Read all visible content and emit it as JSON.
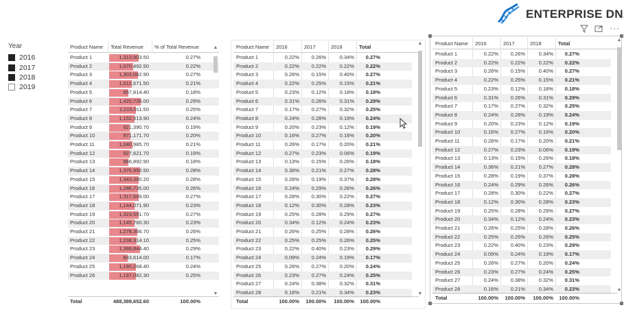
{
  "logo": {
    "text_main": "ENTERPRISE",
    "text_accent": "DNA"
  },
  "visual_header": {
    "filter_icon": "filter-icon",
    "focus_icon": "focus-mode-icon",
    "more_icon": "more-options-icon"
  },
  "slicer": {
    "title": "Year",
    "items": [
      {
        "label": "2016",
        "checked": true
      },
      {
        "label": "2017",
        "checked": true
      },
      {
        "label": "2018",
        "checked": true
      },
      {
        "label": "2019",
        "checked": false
      }
    ]
  },
  "table1": {
    "headers": [
      "Product Name",
      "Total Revenue",
      "% of Total Revenue"
    ],
    "rows": [
      [
        "Product 1",
        "1,313,903.50",
        "0.27%"
      ],
      [
        "Product 2",
        "1,070,492.50",
        "0.22%"
      ],
      [
        "Product 3",
        "1,303,062.90",
        "0.27%"
      ],
      [
        "Product 4",
        "1,012,671.50",
        "0.21%"
      ],
      [
        "Product 5",
        "857,814.40",
        "0.18%"
      ],
      [
        "Product 6",
        "1,420,735.00",
        "0.29%"
      ],
      [
        "Product 7",
        "1,215,011.50",
        "0.25%"
      ],
      [
        "Product 8",
        "1,152,513.90",
        "0.24%"
      ],
      [
        "Product 9",
        "921,390.70",
        "0.19%"
      ],
      [
        "Product 10",
        "971,171.70",
        "0.20%"
      ],
      [
        "Product 11",
        "1,040,985.70",
        "0.21%"
      ],
      [
        "Product 12",
        "927,621.70",
        "0.19%"
      ],
      [
        "Product 13",
        "866,892.90",
        "0.18%"
      ],
      [
        "Product 14",
        "1,376,950.50",
        "0.28%"
      ],
      [
        "Product 15",
        "1,343,390.20",
        "0.28%"
      ],
      [
        "Product 16",
        "1,286,735.00",
        "0.26%"
      ],
      [
        "Product 17",
        "1,317,689.00",
        "0.27%"
      ],
      [
        "Product 18",
        "1,144,071.90",
        "0.23%"
      ],
      [
        "Product 19",
        "1,323,591.70",
        "0.27%"
      ],
      [
        "Product 20",
        "1,145,760.30",
        "0.23%"
      ],
      [
        "Product 21",
        "1,278,366.70",
        "0.26%"
      ],
      [
        "Product 22",
        "1,238,314.10",
        "0.25%"
      ],
      [
        "Product 23",
        "1,399,844.40",
        "0.29%"
      ],
      [
        "Product 24",
        "833,614.00",
        "0.17%"
      ],
      [
        "Product 25",
        "1,190,268.40",
        "0.24%"
      ],
      [
        "Product 26",
        "1,197,082.30",
        "0.25%"
      ]
    ],
    "bar_values": [
      1313903.5,
      1070492.5,
      1303062.9,
      1012671.5,
      857814.4,
      1420735.0,
      1215011.5,
      1152513.9,
      921390.7,
      971171.7,
      1040985.7,
      927621.7,
      866892.9,
      1376950.5,
      1343390.2,
      1286735.0,
      1317689.0,
      1144071.9,
      1323591.7,
      1145760.3,
      1278366.7,
      1238314.1,
      1399844.4,
      833614.0,
      1190268.4,
      1197082.3
    ],
    "bar_max": 1420735.0,
    "total": [
      "Total",
      "488,389,652.60",
      "100.00%"
    ],
    "bar_color": "#e8878c"
  },
  "table2": {
    "headers": [
      "Product Name",
      "2016",
      "2017",
      "2018",
      "Total"
    ],
    "rows": [
      [
        "Product 1",
        "0.22%",
        "0.26%",
        "0.34%",
        "0.27%"
      ],
      [
        "Product 2",
        "0.22%",
        "0.22%",
        "0.22%",
        "0.22%"
      ],
      [
        "Product 3",
        "0.26%",
        "0.15%",
        "0.40%",
        "0.27%"
      ],
      [
        "Product 4",
        "0.22%",
        "0.25%",
        "0.15%",
        "0.21%"
      ],
      [
        "Product 5",
        "0.23%",
        "0.12%",
        "0.18%",
        "0.18%"
      ],
      [
        "Product 6",
        "0.31%",
        "0.26%",
        "0.31%",
        "0.29%"
      ],
      [
        "Product 7",
        "0.17%",
        "0.27%",
        "0.32%",
        "0.25%"
      ],
      [
        "Product 8",
        "0.24%",
        "0.28%",
        "0.19%",
        "0.24%"
      ],
      [
        "Product 9",
        "0.20%",
        "0.23%",
        "0.12%",
        "0.19%"
      ],
      [
        "Product 10",
        "0.16%",
        "0.27%",
        "0.16%",
        "0.20%"
      ],
      [
        "Product 11",
        "0.26%",
        "0.17%",
        "0.20%",
        "0.21%"
      ],
      [
        "Product 12",
        "0.27%",
        "0.23%",
        "0.06%",
        "0.19%"
      ],
      [
        "Product 13",
        "0.13%",
        "0.15%",
        "0.26%",
        "0.18%"
      ],
      [
        "Product 14",
        "0.36%",
        "0.21%",
        "0.27%",
        "0.28%"
      ],
      [
        "Product 15",
        "0.28%",
        "0.19%",
        "0.37%",
        "0.28%"
      ],
      [
        "Product 16",
        "0.24%",
        "0.29%",
        "0.26%",
        "0.26%"
      ],
      [
        "Product 17",
        "0.28%",
        "0.30%",
        "0.22%",
        "0.27%"
      ],
      [
        "Product 18",
        "0.12%",
        "0.30%",
        "0.28%",
        "0.23%"
      ],
      [
        "Product 19",
        "0.25%",
        "0.28%",
        "0.29%",
        "0.27%"
      ],
      [
        "Product 20",
        "0.34%",
        "0.12%",
        "0.24%",
        "0.23%"
      ],
      [
        "Product 21",
        "0.26%",
        "0.25%",
        "0.28%",
        "0.26%"
      ],
      [
        "Product 22",
        "0.25%",
        "0.25%",
        "0.26%",
        "0.25%"
      ],
      [
        "Product 23",
        "0.22%",
        "0.40%",
        "0.23%",
        "0.29%"
      ],
      [
        "Product 24",
        "0.09%",
        "0.24%",
        "0.19%",
        "0.17%"
      ],
      [
        "Product 25",
        "0.26%",
        "0.27%",
        "0.20%",
        "0.24%"
      ],
      [
        "Product 26",
        "0.23%",
        "0.27%",
        "0.24%",
        "0.25%"
      ],
      [
        "Product 27",
        "0.24%",
        "0.38%",
        "0.32%",
        "0.31%"
      ],
      [
        "Product 28",
        "0.16%",
        "0.21%",
        "0.34%",
        "0.23%"
      ]
    ],
    "total": [
      "Total",
      "100.00%",
      "100.00%",
      "100.00%",
      "100.00%"
    ]
  },
  "table3": {
    "headers": [
      "Product Name",
      "2016",
      "2017",
      "2018",
      "Total"
    ],
    "rows": [
      [
        "Product 1",
        "0.22%",
        "0.26%",
        "0.34%",
        "0.27%"
      ],
      [
        "Product 2",
        "0.22%",
        "0.22%",
        "0.22%",
        "0.22%"
      ],
      [
        "Product 3",
        "0.26%",
        "0.15%",
        "0.40%",
        "0.27%"
      ],
      [
        "Product 4",
        "0.22%",
        "0.25%",
        "0.15%",
        "0.21%"
      ],
      [
        "Product 5",
        "0.23%",
        "0.12%",
        "0.18%",
        "0.18%"
      ],
      [
        "Product 6",
        "0.31%",
        "0.26%",
        "0.31%",
        "0.29%"
      ],
      [
        "Product 7",
        "0.17%",
        "0.27%",
        "0.32%",
        "0.25%"
      ],
      [
        "Product 8",
        "0.24%",
        "0.28%",
        "0.19%",
        "0.24%"
      ],
      [
        "Product 9",
        "0.20%",
        "0.23%",
        "0.12%",
        "0.19%"
      ],
      [
        "Product 10",
        "0.16%",
        "0.27%",
        "0.16%",
        "0.20%"
      ],
      [
        "Product 11",
        "0.26%",
        "0.17%",
        "0.20%",
        "0.21%"
      ],
      [
        "Product 12",
        "0.27%",
        "0.23%",
        "0.06%",
        "0.19%"
      ],
      [
        "Product 13",
        "0.13%",
        "0.15%",
        "0.26%",
        "0.18%"
      ],
      [
        "Product 14",
        "0.36%",
        "0.21%",
        "0.27%",
        "0.28%"
      ],
      [
        "Product 15",
        "0.28%",
        "0.19%",
        "0.37%",
        "0.28%"
      ],
      [
        "Product 16",
        "0.24%",
        "0.29%",
        "0.26%",
        "0.26%"
      ],
      [
        "Product 17",
        "0.28%",
        "0.30%",
        "0.22%",
        "0.27%"
      ],
      [
        "Product 18",
        "0.12%",
        "0.30%",
        "0.28%",
        "0.23%"
      ],
      [
        "Product 19",
        "0.25%",
        "0.28%",
        "0.29%",
        "0.27%"
      ],
      [
        "Product 20",
        "0.34%",
        "0.12%",
        "0.24%",
        "0.23%"
      ],
      [
        "Product 21",
        "0.26%",
        "0.25%",
        "0.28%",
        "0.26%"
      ],
      [
        "Product 22",
        "0.25%",
        "0.25%",
        "0.26%",
        "0.25%"
      ],
      [
        "Product 23",
        "0.22%",
        "0.40%",
        "0.23%",
        "0.29%"
      ],
      [
        "Product 24",
        "0.09%",
        "0.24%",
        "0.19%",
        "0.17%"
      ],
      [
        "Product 25",
        "0.26%",
        "0.27%",
        "0.20%",
        "0.24%"
      ],
      [
        "Product 26",
        "0.23%",
        "0.27%",
        "0.24%",
        "0.25%"
      ],
      [
        "Product 27",
        "0.24%",
        "0.38%",
        "0.32%",
        "0.31%"
      ],
      [
        "Product 28",
        "0.16%",
        "0.21%",
        "0.34%",
        "0.23%"
      ]
    ],
    "total": [
      "Total",
      "100.00%",
      "100.00%",
      "100.00%",
      "100.00%"
    ]
  }
}
